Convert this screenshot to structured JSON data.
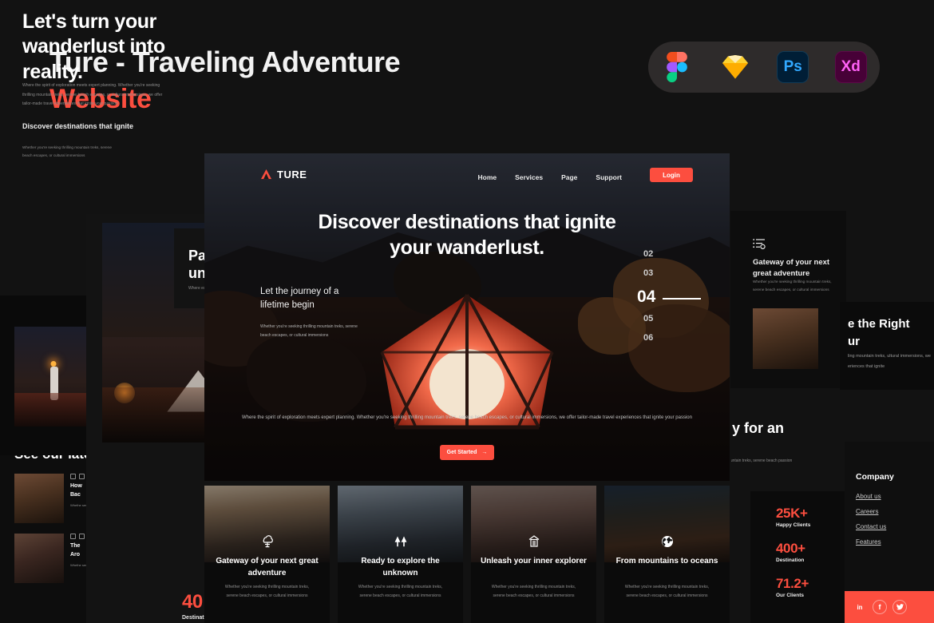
{
  "header": {
    "title": "Ture - Traveling Adventure",
    "subtitle": "Website",
    "apps": [
      {
        "name": "figma",
        "label": ""
      },
      {
        "name": "sketch",
        "label": ""
      },
      {
        "name": "photoshop",
        "label": "Ps"
      },
      {
        "name": "xd",
        "label": "Xd"
      }
    ]
  },
  "colors": {
    "accent": "#fc4e3f",
    "background": "#121212",
    "panel": "#0e0e0e",
    "text": "#ffffff",
    "muted": "#8e8e8e"
  },
  "hero": {
    "logo_text": "TURE",
    "nav": [
      "Home",
      "Services",
      "Page",
      "Support"
    ],
    "login_label": "Login",
    "headline": "Discover destinations that ignite your wanderlust.",
    "headline_line1": "Discover destinations that ignite",
    "headline_line2": "your wanderlust.",
    "left_heading": "Let the journey of a lifetime begin",
    "left_paragraph": "Whether you're seeking thrilling mountain treks, serene beach escapes, or cultural immersions",
    "slides": [
      "02",
      "03",
      "04",
      "05",
      "06"
    ],
    "active_slide": "04",
    "footer_paragraph": "Where the spirit of exploration meets expert planning. Whether you're seeking thrilling mountain treks, serene beach escapes, or cultural immersions, we offer tailor-made travel experiences that ignite your passion",
    "cta_label": "Get Started",
    "cta_arrow": "→"
  },
  "cards": [
    {
      "icon": "tree-icon",
      "title": "Gateway of your next great adventure",
      "text": "Whether you're seeking thrilling mountain treks, serene beach escapes, or cultural immersions"
    },
    {
      "icon": "forest-icon",
      "title": "Ready to explore the unknown",
      "text": "Whether you're seeking thrilling mountain treks, serene beach escapes, or cultural immersions"
    },
    {
      "icon": "monument-icon",
      "title": "Unleash your inner explorer",
      "text": "Whether you're seeking thrilling mountain treks, serene beach escapes, or cultural immersions"
    },
    {
      "icon": "globe-icon",
      "title": "From mountains to oceans",
      "text": "Whether you're seeking thrilling mountain treks, serene beach escapes, or cultural immersions"
    }
  ],
  "blog_panel": {
    "title": "See our latest",
    "items": [
      {
        "heading_line1": "How",
        "heading_line2": "Bac",
        "text": "Whethe serene offer ta your pa"
      },
      {
        "heading_line1": "The",
        "heading_line2": "Aro",
        "text": "Whethe serene offer ta your pa"
      }
    ]
  },
  "pack_panel": {
    "heading_line1": "Pa",
    "heading_line2": "un",
    "text": "Where escape"
  },
  "wanderlust_panel": {
    "heading": "Let's turn your wanderlust into reality.",
    "paragraph": "Where the spirit of exploration meets expert planning. Whether you're seeking thrilling mountain treks, serene beach escapes, or cultural immersions, we offer tailor-made travel experiences that ignite your passion",
    "sub_heading": "Discover destinations that ignite",
    "sub_paragraph": "Whether you're seeking thrilling mountain treks, serene beach escapes, or cultural immersions",
    "stat_number": "40",
    "stat_label": "Destination"
  },
  "gateway_panel": {
    "icon": "list-settings-icon",
    "heading": "Gateway of your next great adventure",
    "text": "Whether you're seeking thrilling mountain treks, serene beach escapes, or cultural immersions"
  },
  "tour_panel": {
    "heading_line1": "e the Right",
    "heading_line2": "ur",
    "text": "ling mountain treks, ultural immersions, we eriences that ignite"
  },
  "ready_panel": {
    "heading": "ly for an",
    "text": "ountain treks, serene beach passion"
  },
  "stats_panel": [
    {
      "number": "25K+",
      "label": "Happy Clients"
    },
    {
      "number": "400+",
      "label": "Destination"
    },
    {
      "number": "71.2+",
      "label": "Our Clients"
    }
  ],
  "company_panel": {
    "heading": "Company",
    "links": [
      "About us",
      "Careers",
      "Contact us",
      "Features"
    ],
    "social": [
      "linkedin-icon",
      "facebook-icon",
      "twitter-icon"
    ]
  }
}
